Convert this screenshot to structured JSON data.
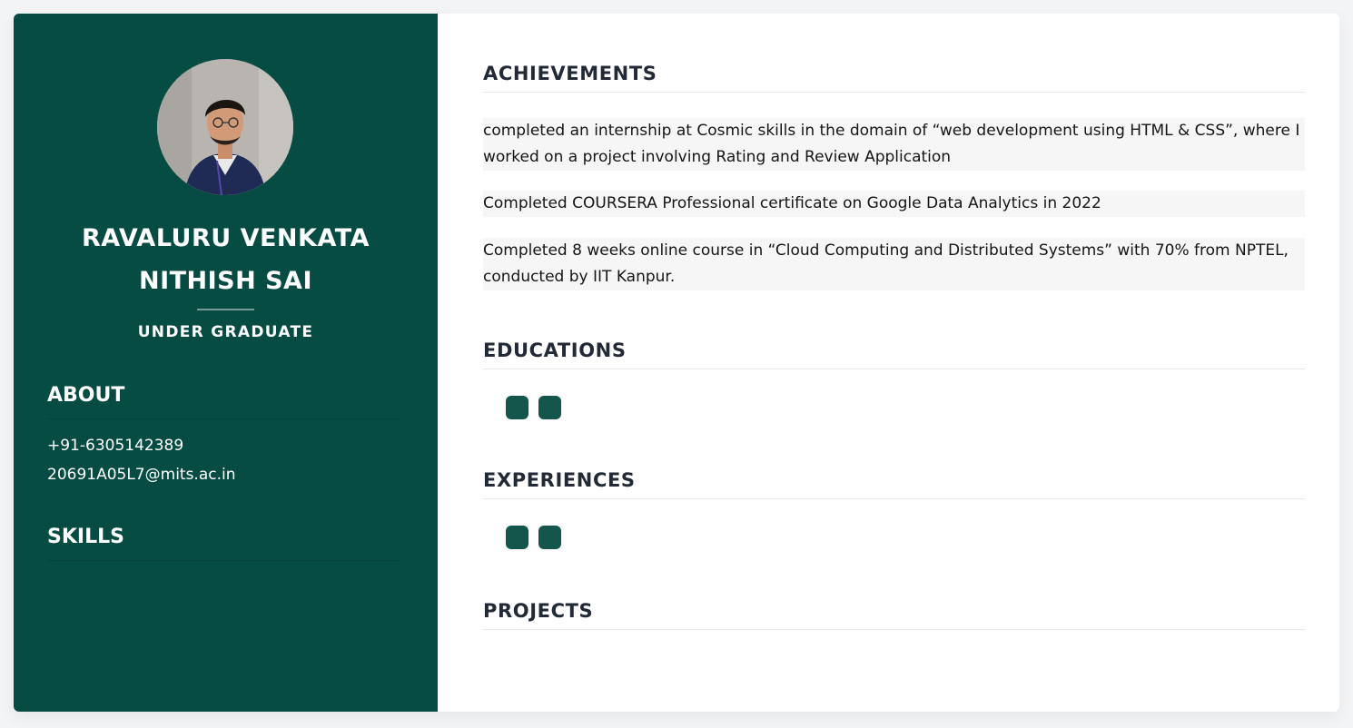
{
  "profile": {
    "name_line1": "RAVALURU VENKATA",
    "name_line2": "NITHISH SAI",
    "role": "UNDER GRADUATE"
  },
  "about": {
    "heading": "ABOUT",
    "phone": "+91-6305142389",
    "email": "20691A05L7@mits.ac.in"
  },
  "skills": {
    "heading": "SKILLS"
  },
  "achievements": {
    "heading": "ACHIEVEMENTS",
    "items": [
      "completed an internship at Cosmic skills in the domain of “web development using HTML & CSS”, where I worked on a project involving Rating and Review Application",
      "Completed COURSERA Professional certificate on Google Data Analytics in 2022",
      "Completed 8 weeks online course in “Cloud Computing and Distributed Systems” with 70% from NPTEL, conducted by IIT Kanpur."
    ]
  },
  "educations": {
    "heading": "EDUCATIONS"
  },
  "experiences": {
    "heading": "EXPERIENCES"
  },
  "projects": {
    "heading": "PROJECTS"
  },
  "colors": {
    "sidebar_bg": "#074c42",
    "pill": "#14564b",
    "heading_text": "#232a37"
  }
}
